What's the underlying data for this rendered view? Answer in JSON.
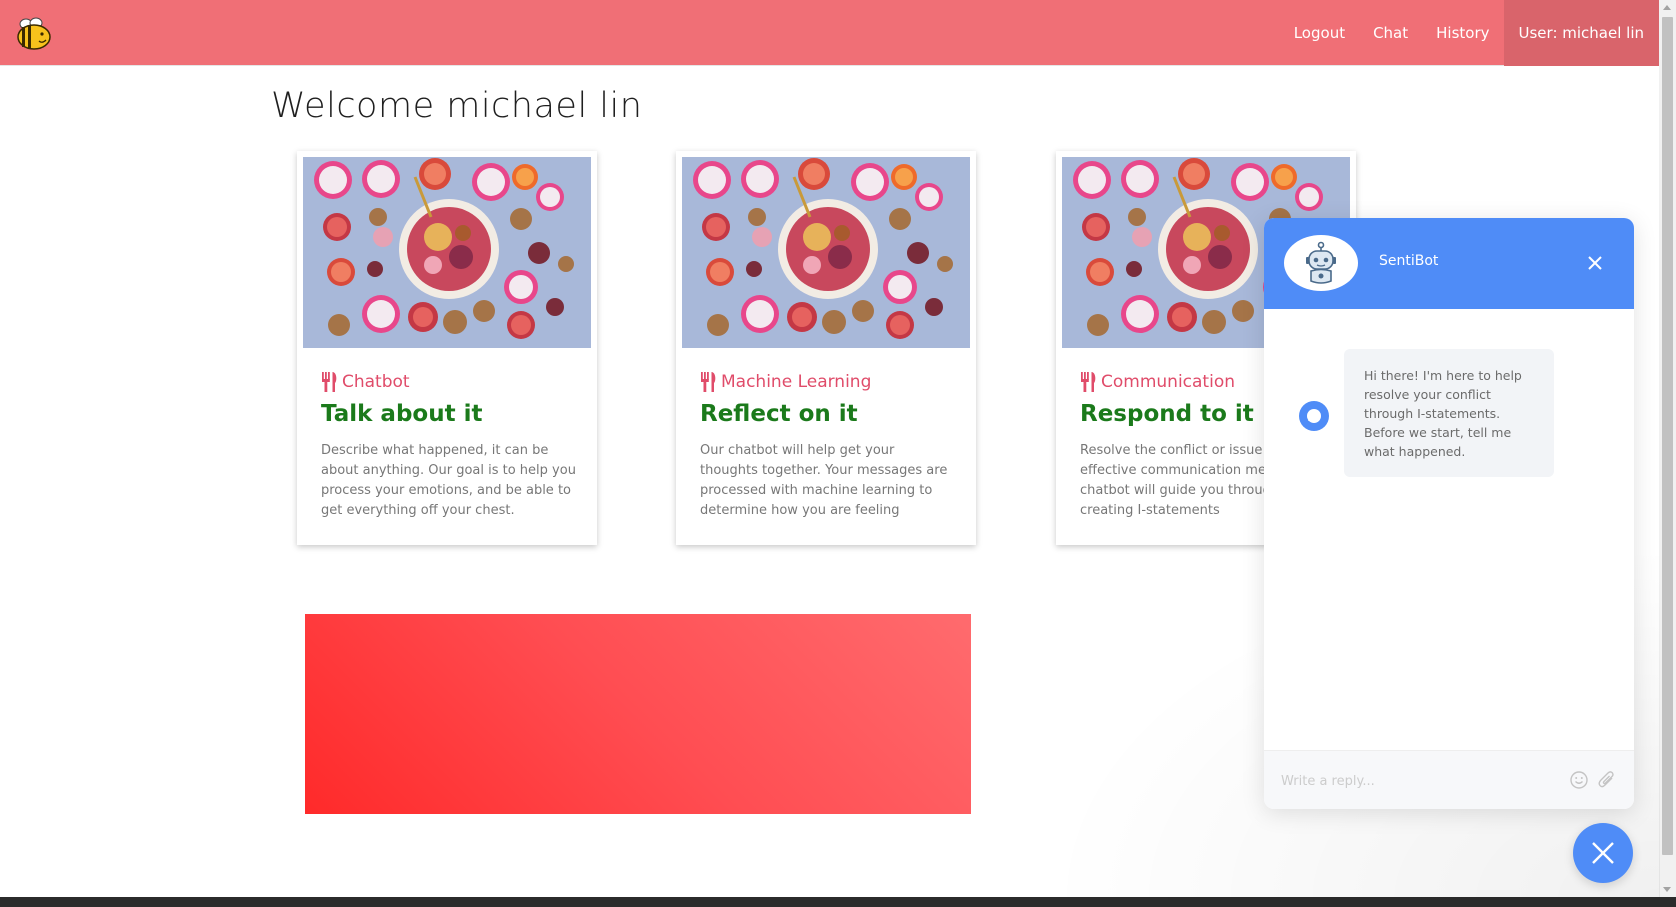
{
  "nav": {
    "logout": "Logout",
    "chat": "Chat",
    "history": "History",
    "user": "User: michael lin"
  },
  "welcome": "Welcome michael lin",
  "cards": [
    {
      "category": "Chatbot",
      "title": "Talk about it",
      "description": "Describe what happened, it can be about anything. Our goal is to help you process your emotions, and be able to get everything off your chest."
    },
    {
      "category": "Machine Learning",
      "title": "Reflect on it",
      "description": "Our chatbot will help get your thoughts together. Your messages are processed with machine learning to determine how you are feeling"
    },
    {
      "category": "Communication",
      "title": "Respond to it",
      "description": "Resolve the conflict or issue with effective communication methods. Our chatbot will guide you through creating I-statements"
    }
  ],
  "chat": {
    "bot_name": "SentiBot",
    "message": "Hi there! I'm here to help resolve your conflict through I-statements. Before we start, tell me what happened.",
    "reply_placeholder": "Write a reply..."
  },
  "colors": {
    "navbar": "#f06f76",
    "accent_blue": "#4f8cf7",
    "category_pink": "#e04c6a",
    "title_green": "#1b7a1b"
  },
  "icons": {
    "logo": "bee-logo-icon",
    "category": "fork-knife-icon",
    "close": "close-icon",
    "emoji": "smiley-icon",
    "attach": "paperclip-icon",
    "message": "chat-bubble-icon",
    "bot": "robot-icon"
  }
}
